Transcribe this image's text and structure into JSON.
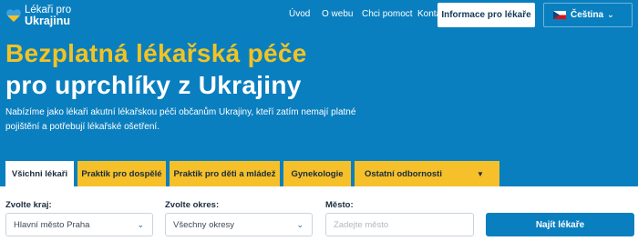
{
  "header": {
    "logo_line1": "Lékaři pro",
    "logo_line2": "Ukrajinu",
    "nav": [
      "Úvod",
      "O webu",
      "Chci pomoct",
      "Kontakty"
    ],
    "cta_label": "Informace pro lékaře",
    "language": "Čeština"
  },
  "hero": {
    "title_line1": "Bezplatná lékařská péče",
    "title_line2": "pro uprchlíky z Ukrajiny",
    "description": "Nabízíme jako lékaři akutní lékařskou péči občanům Ukrajiny, kteří zatím nemají platné pojištění a potřebují lékařské ošetření."
  },
  "tabs": [
    {
      "label": "Všichni lékaři",
      "active": true
    },
    {
      "label": "Praktik pro dospělé",
      "active": false
    },
    {
      "label": "Praktik pro děti a mládež",
      "active": false
    },
    {
      "label": "Gynekologie",
      "active": false
    },
    {
      "label": "Ostatní odbornosti",
      "active": false
    }
  ],
  "search": {
    "region_label": "Zvolte kraj:",
    "region_value": "Hlavní město Praha",
    "district_label": "Zvolte okres:",
    "district_value": "Všechny okresy",
    "city_label": "Město:",
    "city_placeholder": "Zadejte město",
    "submit_label": "Najít lékaře"
  },
  "colors": {
    "primary_blue": "#0a7fbf",
    "accent_yellow": "#f5c02a",
    "title_yellow": "#f2c324"
  },
  "icons": {
    "logo": "heart-ukraine-icon",
    "flag": "czech-flag-icon",
    "dropdown": "chevron-down-icon"
  }
}
